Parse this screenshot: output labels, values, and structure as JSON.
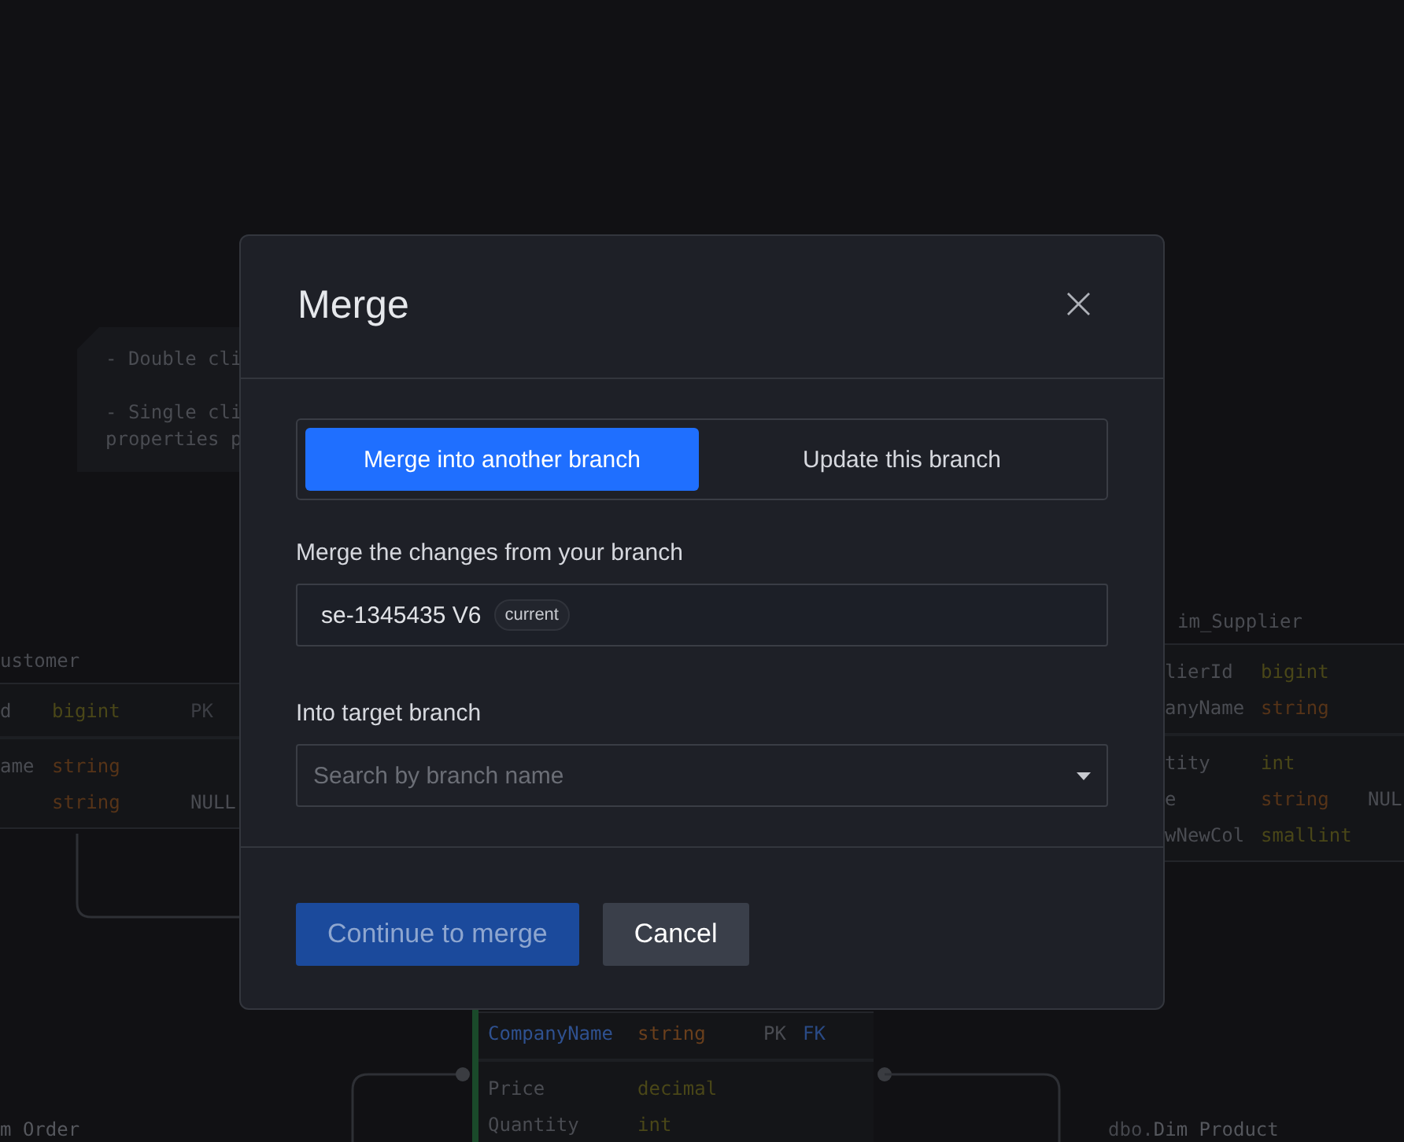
{
  "canvas": {
    "note": {
      "paragraphs": [
        {
          "lines": [
            "- Double cli"
          ]
        },
        {
          "lines": [
            "- Single cli",
            "properties p"
          ]
        }
      ]
    },
    "tables": [
      {
        "title": "ustomer",
        "sections": [
          [
            {
              "name": "d",
              "type": "bigint",
              "color": "#4a4718",
              "tags": [
                {
                  "text": "PK",
                  "color": "#3c3e44"
                }
              ]
            }
          ],
          [
            {
              "name": "ame",
              "type": "string",
              "color": "#573418"
            },
            {
              "type": "string",
              "color": "#573418",
              "tags": [
                {
                  "text": "NULL",
                  "color": "#4a4c52"
                }
              ]
            }
          ]
        ]
      },
      {
        "title": "im_Supplier",
        "sections": [
          [
            {
              "name": "lierId",
              "type": "bigint",
              "color": "#4a4718"
            },
            {
              "name": "anyName",
              "type": "string",
              "color": "#573418"
            }
          ],
          [
            {
              "name": "tity",
              "type": "int",
              "color": "#4a4718"
            },
            {
              "name": "e",
              "type": "string",
              "color": "#573418",
              "tags": [
                {
                  "text": "NUL",
                  "color": "#4a4c52"
                }
              ]
            },
            {
              "name": "wNewCol",
              "type": "smallint",
              "color": "#4a4718"
            }
          ]
        ]
      },
      {
        "sections": [
          [
            {
              "name": "CompanyName",
              "type": "string",
              "color": "#6a3f1c",
              "tags": [
                {
                  "text": "PK",
                  "color": "#4a4c52"
                },
                {
                  "text": "FK",
                  "color": "#2a4a85"
                }
              ]
            }
          ],
          [
            {
              "name": "Price",
              "type": "decimal",
              "color": "#4a4718"
            },
            {
              "name": "Quantity",
              "type": "int",
              "color": "#4a4718"
            }
          ]
        ]
      }
    ],
    "labels": [
      {
        "name": "m Order"
      },
      {
        "prefix": "dbo.",
        "name": "Dim Product"
      }
    ]
  },
  "dialog": {
    "title": "Merge",
    "close": "×",
    "modes": [
      {
        "label": "Merge into another branch",
        "selected": true
      },
      {
        "label": "Update this branch",
        "selected": false
      }
    ],
    "source": {
      "label": "Merge the changes from your branch",
      "value": "se-1345435 V6",
      "badge": "current"
    },
    "target": {
      "label": "Into target branch",
      "placeholder": "Search by branch name"
    },
    "buttons": [
      {
        "label": "Continue to merge",
        "kind": "primary",
        "disabled": true
      },
      {
        "label": "Cancel",
        "kind": "secondary"
      }
    ]
  }
}
